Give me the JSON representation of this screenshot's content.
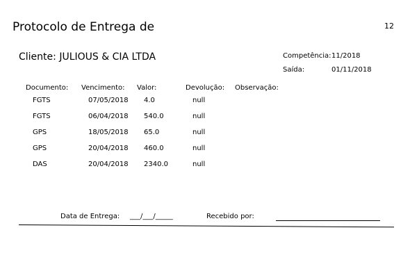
{
  "header": {
    "title": "Protocolo de Entrega de",
    "page_number": "12"
  },
  "client": {
    "label": "Cliente:",
    "name": "JULIOUS & CIA LTDA"
  },
  "meta": {
    "competencia_label": "Competência:",
    "competencia_value": "11/2018",
    "saida_label": "Saída:",
    "saida_value": "01/11/2018"
  },
  "table": {
    "headers": {
      "documento": "Documento:",
      "vencimento": "Vencimento:",
      "valor": "Valor:",
      "devolucao": "Devolução:",
      "observacao": "Observação:"
    },
    "rows": [
      {
        "documento": "FGTS",
        "vencimento": "07/05/2018",
        "valor": "4.0",
        "devolucao": "null"
      },
      {
        "documento": "FGTS",
        "vencimento": "06/04/2018",
        "valor": "540.0",
        "devolucao": "null"
      },
      {
        "documento": "GPS",
        "vencimento": "18/05/2018",
        "valor": "65.0",
        "devolucao": "null"
      },
      {
        "documento": "GPS",
        "vencimento": "20/04/2018",
        "valor": "460.0",
        "devolucao": "null"
      },
      {
        "documento": "DAS",
        "vencimento": "20/04/2018",
        "valor": "2340.0",
        "devolucao": "null"
      }
    ]
  },
  "footer": {
    "data_entrega_label": "Data de Entrega:",
    "data_entrega_blank": "___/___/_____",
    "recebido_label": "Recebido por:"
  }
}
